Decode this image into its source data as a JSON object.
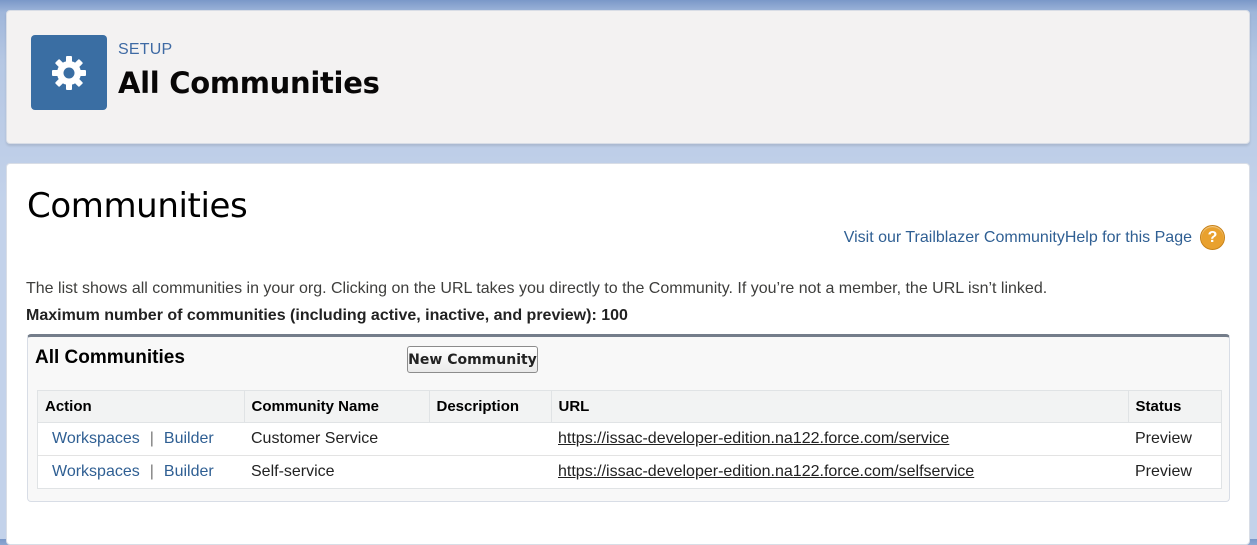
{
  "header": {
    "icon": "gear-icon",
    "breadcrumb": "SETUP",
    "title": "All Communities"
  },
  "main": {
    "page_title": "Communities",
    "help_link": "Visit our Trailblazer CommunityHelp for this Page",
    "help_icon": "help-question-icon",
    "description": "The list shows all communities in your org. Clicking on the URL takes you directly to the Community. If you’re not a member, the URL isn’t linked.",
    "max_notice": "Maximum number of communities (including active, inactive, and preview): 100"
  },
  "list": {
    "title": "All Communities",
    "new_button": "New Community",
    "columns": [
      "Action",
      "Community Name",
      "Description",
      "URL",
      "Status"
    ],
    "separator": "|",
    "rows": [
      {
        "workspaces": "Workspaces",
        "builder": "Builder",
        "name": "Customer Service",
        "description": "",
        "url": "https://issac-developer-edition.na122.force.com/service",
        "status": "Preview"
      },
      {
        "workspaces": "Workspaces",
        "builder": "Builder",
        "name": "Self-service",
        "description": "",
        "url": "https://issac-developer-edition.na122.force.com/selfservice",
        "status": "Preview"
      }
    ]
  },
  "colors": {
    "icon_bg": "#3a6ea3",
    "link": "#2f5f93",
    "help_icon": "#e9a12e"
  }
}
